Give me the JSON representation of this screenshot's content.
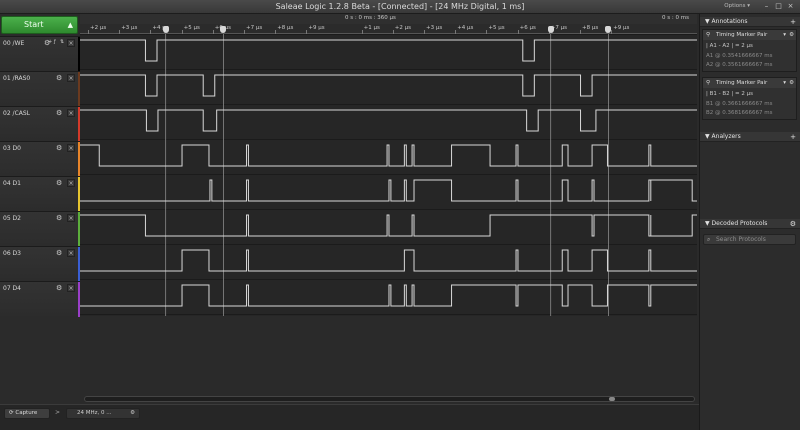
{
  "window": {
    "title": "Saleae Logic 1.2.8 Beta - [Connected] - [24 MHz Digital, 1 ms]",
    "options_label": "Options ▾",
    "controls": [
      "–",
      "□",
      "×"
    ]
  },
  "start_button": {
    "label": "Start",
    "arrow": "▲"
  },
  "channels": [
    {
      "label": "00  /WE",
      "color": "#000000",
      "gear": "⚙",
      "close": "×",
      "extras": [
        "+",
        "ƒ",
        "⇅"
      ]
    },
    {
      "label": "01  /RAS0",
      "color": "#6b3a1f",
      "gear": "⚙",
      "close": "×",
      "extras": []
    },
    {
      "label": "02  /CASL",
      "color": "#d43a2a",
      "gear": "⚙",
      "close": "×",
      "extras": []
    },
    {
      "label": "03  D0",
      "color": "#e8852a",
      "gear": "⚙",
      "close": "×",
      "extras": []
    },
    {
      "label": "04  D1",
      "color": "#e6c52f",
      "gear": "⚙",
      "close": "×",
      "extras": []
    },
    {
      "label": "05  D2",
      "color": "#5cae3c",
      "gear": "⚙",
      "close": "×",
      "extras": []
    },
    {
      "label": "06  D3",
      "color": "#3a5fd4",
      "gear": "⚙",
      "close": "×",
      "extras": []
    },
    {
      "label": "07  D4",
      "color": "#9a3fc9",
      "gear": "⚙",
      "close": "×",
      "extras": []
    }
  ],
  "timebar": {
    "center_label": "0 s : 0 ms : 360 µs",
    "right_label": "0 s : 0 ms",
    "ruler_labels": [
      "+2 µs",
      "+3 µs",
      "+4 µs",
      "+5 µs",
      "+6 µs",
      "+7 µs",
      "+8 µs",
      "+9 µs",
      "+1 µs",
      "+2 µs",
      "+3 µs",
      "+4 µs",
      "+5 µs",
      "+6 µs",
      "+7 µs",
      "+8 µs",
      "+9 µs"
    ]
  },
  "markers": [
    {
      "name": "A1",
      "t": 4.45
    },
    {
      "name": "A2",
      "t": 7.45
    },
    {
      "name": "B1",
      "t": 24.45
    },
    {
      "name": "B2",
      "t": 27.45
    }
  ],
  "view_range": [
    0,
    32.05
  ],
  "waveforms": [
    {
      "initial": 1,
      "edges": [
        3.4,
        4.0,
        23.0,
        23.6
      ]
    },
    {
      "initial": 1,
      "edges": [
        3.4,
        4.0,
        6.4,
        7.0,
        23.0,
        23.6,
        26.0,
        26.6
      ]
    },
    {
      "initial": 1,
      "edges": [
        3.45,
        4.05,
        6.4,
        7.1,
        23.2,
        23.8,
        26.0,
        26.8
      ]
    },
    {
      "initial": 1,
      "edges": [
        1.0,
        5.3,
        6.7,
        8.65,
        8.75,
        15.95,
        16.05,
        16.85,
        16.95,
        17.25,
        17.35,
        19.3,
        21.3,
        22.65,
        22.75,
        25.05,
        25.35,
        26.6,
        27.4,
        29.55,
        29.65
      ]
    },
    {
      "initial": 0,
      "edges": [
        6.75,
        6.85,
        8.65,
        8.75,
        16.05,
        16.15,
        16.85,
        16.95,
        17.35,
        19.3,
        22.65,
        22.75,
        25.05,
        25.35,
        26.6,
        26.7,
        29.55,
        29.65,
        29.65,
        31.8
      ]
    },
    {
      "initial": 1,
      "edges": [
        3.4,
        8.65,
        8.75,
        15.95,
        16.05,
        17.25,
        17.35,
        21.3,
        26.6,
        26.7,
        29.55,
        29.65,
        29.65,
        31.8
      ]
    },
    {
      "initial": 0,
      "edges": [
        5.3,
        6.7,
        8.65,
        8.75,
        16.85,
        17.35,
        22.65,
        22.75,
        25.05,
        25.35,
        26.6,
        27.4,
        29.55,
        29.65
      ]
    },
    {
      "initial": 0,
      "edges": [
        5.3,
        6.7,
        8.65,
        8.75,
        16.05,
        16.15,
        16.85,
        16.95,
        17.25,
        17.35,
        19.3,
        22.65,
        22.75,
        25.05,
        25.35,
        26.6,
        27.4,
        29.55,
        29.65
      ]
    }
  ],
  "annotations": {
    "title": "Annotations",
    "pairs": [
      {
        "title": "Timing Marker Pair",
        "summary": "| A1 - A2 | = 2 µs",
        "m1": "A1  @  0.3541666667 ms",
        "m2": "A2  @  0.3561666667 ms"
      },
      {
        "title": "Timing Marker Pair",
        "summary": "| B1 - B2 | = 2 µs",
        "m1": "B1  @  0.3661666667 ms",
        "m2": "B2  @  0.3681666667 ms"
      }
    ]
  },
  "analyzers": {
    "title": "Analyzers"
  },
  "decoded": {
    "title": "Decoded Protocols",
    "search_placeholder": "Search Protocols"
  },
  "bottom": {
    "tab_capture": "Capture",
    "sep": ">",
    "tab_session": "24 MHz, 0 ..."
  },
  "colors": {
    "waveform": "#d8d8d8",
    "marker_line": "#8a8a8a",
    "start_green": "#3a9a3a",
    "background": "#262626"
  }
}
